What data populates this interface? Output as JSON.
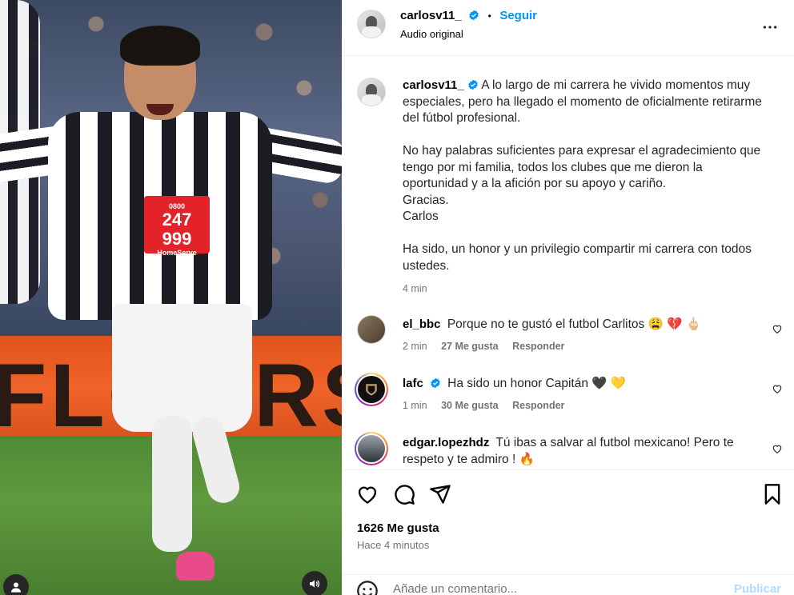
{
  "post": {
    "author": "carlosv11_",
    "follow_label": "Seguir",
    "separator": "•",
    "audio": "Audio original"
  },
  "caption": {
    "author": "carlosv11_",
    "lines": [
      "A lo largo de mi carrera he vivido momentos muy",
      "especiales, pero ha llegado el momento de oficialmente retirarme",
      "del fútbol profesional.",
      "No hay palabras suficientes para expresar el agradecimiento que",
      "tengo por mi familia, todos los clubes que me dieron la",
      "oportunidad y a la afición por su apoyo y cariño.",
      "Gracias.",
      "Carlos",
      "Ha sido, un honor y un privilegio compartir mi carrera con todos",
      "ustedes."
    ],
    "time": "4 min"
  },
  "comments": [
    {
      "username": "el_bbc",
      "text": "Porque no te gustó el futbol Carlitos 😩 💔 🖕🏻",
      "time": "2 min",
      "likes": "27 Me gusta",
      "reply": "Responder"
    },
    {
      "username": "lafc",
      "text": "Ha sido un honor Capitán 🖤 💛",
      "time": "1 min",
      "likes": "30 Me gusta",
      "reply": "Responder"
    },
    {
      "username": "edgar.lopezhdz",
      "text": "Tú ibas a salvar al futbol mexicano! Pero te",
      "text2": "respeto y te admiro ! 🔥"
    }
  ],
  "footer": {
    "likes": "1626 Me gusta",
    "time_ago": "Hace 4 minutos",
    "comment_placeholder": "Añade un comentario...",
    "publish_label": "Publicar"
  },
  "media": {
    "sponsor_line1": "0800",
    "sponsor_line2": "247",
    "sponsor_line3": "999",
    "sponsor_line4": "HomeServe",
    "board_text": "FLOORS-"
  },
  "colors": {
    "link_blue": "#0095f6",
    "verified_blue": "#0095f6",
    "muted": "#737373",
    "publish_disabled": "#b3dbff"
  },
  "icons": [
    "verified-badge-icon",
    "more-options-icon",
    "heart-icon",
    "comment-icon",
    "share-icon",
    "save-icon",
    "emoji-icon",
    "user-tag-icon",
    "audio-icon"
  ]
}
